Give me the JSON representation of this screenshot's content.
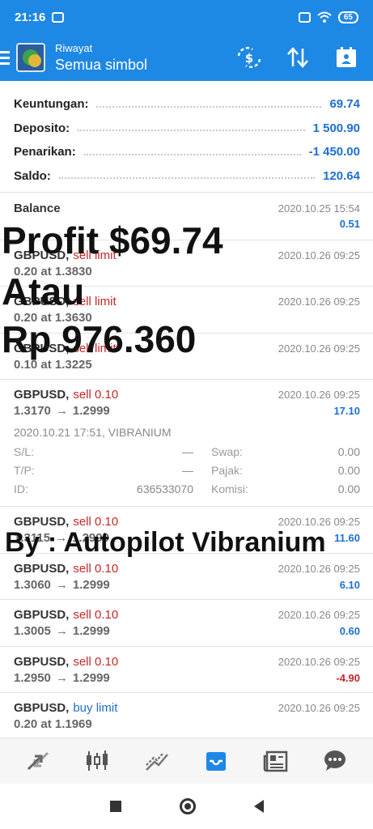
{
  "status_bar": {
    "time": "21:16",
    "battery": "65"
  },
  "app_bar": {
    "subtitle": "Riwayat",
    "title": "Semua simbol"
  },
  "summary": [
    {
      "label": "Keuntungan:",
      "value": "69.74"
    },
    {
      "label": "Deposito:",
      "value": "1 500.90"
    },
    {
      "label": "Penarikan:",
      "value": "-1 450.00"
    },
    {
      "label": "Saldo:",
      "value": "120.64"
    }
  ],
  "deals": [
    {
      "symbol": "Balance",
      "side": "",
      "date": "2020.10.25 15:54",
      "detail": "",
      "profit": "0.51"
    },
    {
      "symbol": "GBPUSD,",
      "side": "sell limit",
      "date": "2020.10.26 09:25",
      "detail": "0.20 at 1.3830",
      "profit": ""
    },
    {
      "symbol": "GBPUSD,",
      "side": "sell limit",
      "date": "2020.10.26 09:25",
      "detail": "0.20 at 1.3630",
      "profit": ""
    },
    {
      "symbol": "GBPUSD,",
      "side": "sell limit",
      "date": "2020.10.26 09:25",
      "detail": "0.10 at 1.3225",
      "profit": ""
    }
  ],
  "expanded_deal": {
    "symbol": "GBPUSD,",
    "side": "sell 0.10",
    "date": "2020.10.26 09:25",
    "open_price": "1.3170",
    "arrow": "→",
    "close_price": "1.2999",
    "profit": "17.10",
    "meta": "2020.10.21 17:51, VIBRANIUM",
    "sl_label": "S/L:",
    "sl_value": "—",
    "swap_label": "Swap:",
    "swap_value": "0.00",
    "tp_label": "T/P:",
    "tp_value": "—",
    "tax_label": "Pajak:",
    "tax_value": "0.00",
    "id_label": "ID:",
    "id_value": "636533070",
    "commission_label": "Komisi:",
    "commission_value": "0.00"
  },
  "deals_after": [
    {
      "symbol": "GBPUSD,",
      "side": "sell 0.10",
      "date": "2020.10.26 09:25",
      "open": "1.3115",
      "close": "1.2999",
      "profit": "11.60",
      "sign": "pos"
    },
    {
      "symbol": "GBPUSD,",
      "side": "sell 0.10",
      "date": "2020.10.26 09:25",
      "open": "1.3060",
      "close": "1.2999",
      "profit": "6.10",
      "sign": "pos"
    },
    {
      "symbol": "GBPUSD,",
      "side": "sell 0.10",
      "date": "2020.10.26 09:25",
      "open": "1.3005",
      "close": "1.2999",
      "profit": "0.60",
      "sign": "pos"
    },
    {
      "symbol": "GBPUSD,",
      "side": "sell 0.10",
      "date": "2020.10.26 09:25",
      "open": "1.2950",
      "close": "1.2999",
      "profit": "-4.90",
      "sign": "neg"
    }
  ],
  "last_deal": {
    "symbol": "GBPUSD,",
    "side": "buy limit",
    "date": "2020.10.26 09:25",
    "detail": "0.20 at 1.1969"
  },
  "overlay": {
    "line1": "Profit $69.74",
    "line2": "Atau",
    "line3": "Rp 976.360",
    "line4": "By : Autopilot Vibranium"
  },
  "colors": {
    "primary": "#1e88e5",
    "positive": "#1e6fd1",
    "negative": "#c62828"
  }
}
